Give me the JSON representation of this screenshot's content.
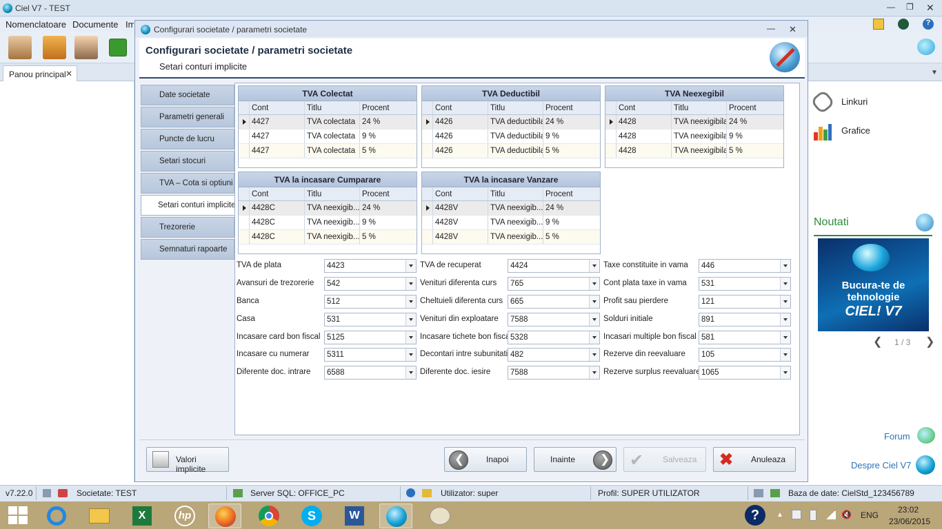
{
  "app": {
    "title": "Ciel V7 - TEST"
  },
  "menu": [
    "Nomenclatoare",
    "Documente",
    "Im"
  ],
  "tab": {
    "label": "Panou principal"
  },
  "dialog": {
    "window_title": "Configurari societate / parametri societate",
    "header_title": "Configurari societate / parametri societate",
    "header_subtitle": "Setari conturi implicite"
  },
  "nav": [
    "Date societate",
    "Parametri generali",
    "Puncte de lucru",
    "Setari stocuri",
    "TVA – Cota si optiuni",
    "Setari conturi implicite",
    "Trezorerie",
    "Semnaturi rapoarte"
  ],
  "grid_columns": [
    "Cont",
    "Titlu",
    "Procent"
  ],
  "grids": [
    {
      "title": "TVA Colectat",
      "rows": [
        [
          "4427",
          "TVA colectata",
          "24 %"
        ],
        [
          "4427",
          "TVA colectata",
          "9 %"
        ],
        [
          "4427",
          "TVA colectata",
          "5 %"
        ]
      ]
    },
    {
      "title": "TVA Deductibil",
      "rows": [
        [
          "4426",
          "TVA deductibila",
          "24 %"
        ],
        [
          "4426",
          "TVA deductibila",
          "9 %"
        ],
        [
          "4426",
          "TVA deductibila",
          "5 %"
        ]
      ]
    },
    {
      "title": "TVA Neexegibil",
      "rows": [
        [
          "4428",
          "TVA neexigibila",
          "24 %"
        ],
        [
          "4428",
          "TVA neexigibila",
          "9 %"
        ],
        [
          "4428",
          "TVA neexigibila",
          "5 %"
        ]
      ]
    },
    {
      "title": "TVA la incasare Cumparare",
      "rows": [
        [
          "4428C",
          "TVA neexigib...",
          "24 %"
        ],
        [
          "4428C",
          "TVA neexigib...",
          "9 %"
        ],
        [
          "4428C",
          "TVA neexigib...",
          "5 %"
        ]
      ]
    },
    {
      "title": "TVA la incasare Vanzare",
      "rows": [
        [
          "4428V",
          "TVA neexigib...",
          "24 %"
        ],
        [
          "4428V",
          "TVA neexigib...",
          "9 %"
        ],
        [
          "4428V",
          "TVA neexigib...",
          "5 %"
        ]
      ]
    }
  ],
  "fields": [
    [
      {
        "label": "TVA de plata",
        "value": "4423"
      },
      {
        "label": "Avansuri de trezorerie",
        "value": "542"
      },
      {
        "label": "Banca",
        "value": "512"
      },
      {
        "label": "Casa",
        "value": "531"
      },
      {
        "label": "Incasare card bon fiscal",
        "value": "5125"
      },
      {
        "label": "Incasare cu numerar",
        "value": "5311"
      },
      {
        "label": "Diferente doc. intrare",
        "value": "6588"
      }
    ],
    [
      {
        "label": "TVA de recuperat",
        "value": "4424"
      },
      {
        "label": "Venituri diferenta curs",
        "value": "765"
      },
      {
        "label": "Cheltuieli diferenta curs",
        "value": "665"
      },
      {
        "label": "Venituri din exploatare",
        "value": "7588"
      },
      {
        "label": "Incasare tichete bon fiscal",
        "value": "5328"
      },
      {
        "label": "Decontari intre subunitati",
        "value": "482"
      },
      {
        "label": "Diferente doc. iesire",
        "value": "7588"
      }
    ],
    [
      {
        "label": "Taxe constituite in vama",
        "value": "446"
      },
      {
        "label": "Cont plata taxe in vama",
        "value": "531"
      },
      {
        "label": "Profit sau pierdere",
        "value": "121"
      },
      {
        "label": "Solduri initiale",
        "value": "891"
      },
      {
        "label": "Incasari multiple bon fiscal",
        "value": "581"
      },
      {
        "label": "Rezerve din reevaluare",
        "value": "105"
      },
      {
        "label": "Rezerve surplus reevaluare",
        "value": "1065"
      }
    ]
  ],
  "buttons": {
    "defaults": "Valori implicite",
    "back": "Inapoi",
    "next": "Inainte",
    "save": "Salveaza",
    "cancel": "Anuleaza"
  },
  "right_panel": {
    "links": "Linkuri",
    "charts": "Grafice",
    "news_title": "Noutati",
    "banner_text": "Bucura-te de tehnologie",
    "banner_brand": "CIEL! V7",
    "pager": "1 / 3",
    "forum": "Forum",
    "about": "Despre Ciel V7"
  },
  "status": {
    "version": "v7.22.0",
    "company": "Societate: TEST",
    "server": "Server SQL: OFFICE_PC",
    "user": "Utilizator: super",
    "profile": "Profil: SUPER UTILIZATOR",
    "database": "Baza de date: CielStd_123456789"
  },
  "taskbar": {
    "lang": "ENG",
    "time": "23:02",
    "date": "23/06/2015",
    "hp_label": "hp"
  },
  "colors": {
    "accent": "#2a73b8",
    "header_border": "#2f4a6b",
    "grid_header": "#c9d6e8"
  }
}
